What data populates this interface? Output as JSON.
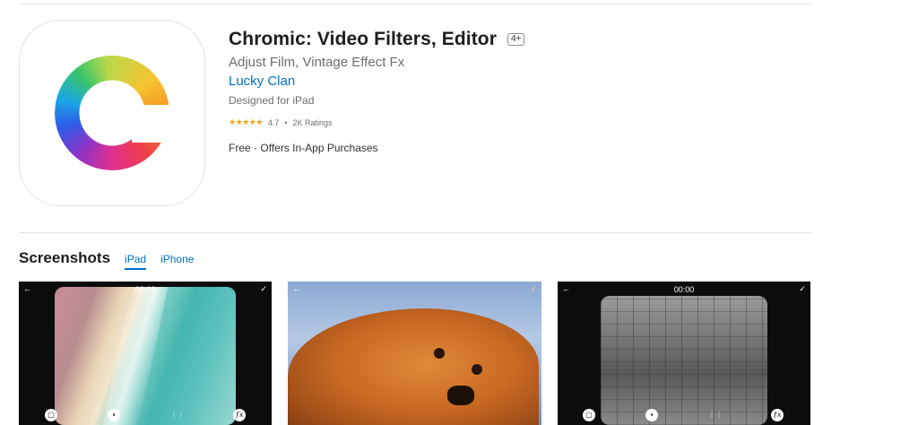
{
  "app": {
    "title": "Chromic: Video Filters, Editor",
    "age_rating": "4+",
    "subtitle": "Adjust Film, Vintage Effect Fx",
    "developer": "Lucky Clan",
    "designed_for": "Designed for iPad",
    "rating_stars": "★★★★★",
    "rating_value": "4.7",
    "rating_separator": "•",
    "rating_count": "2K Ratings",
    "price": "Free",
    "price_separator": "·",
    "in_app": "Offers In-App Purchases"
  },
  "screenshots": {
    "heading": "Screenshots",
    "tabs": [
      {
        "label": "iPad",
        "active": true
      },
      {
        "label": "iPhone",
        "active": false
      }
    ],
    "items": [
      {
        "timecode": "00:02",
        "subject": "beach"
      },
      {
        "timecode": "",
        "subject": "dog"
      },
      {
        "timecode": "00:00",
        "subject": "tennis"
      }
    ]
  },
  "icons": {
    "back": "←",
    "check": "✓",
    "grid": "⋮⋮",
    "fx": "ƒx"
  },
  "colors": {
    "link": "#0070c9",
    "star": "#f0a30a",
    "secondary_text": "#6e6e73"
  }
}
